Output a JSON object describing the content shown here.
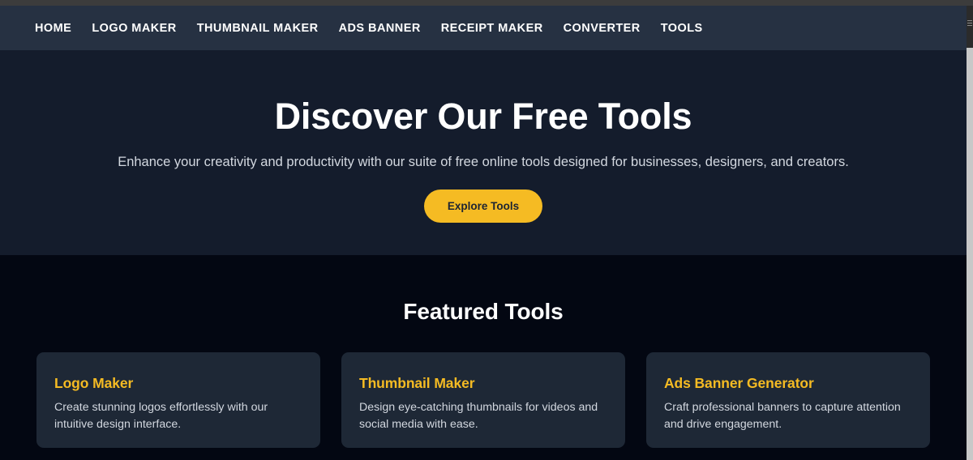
{
  "navbar": {
    "links": [
      {
        "label": "HOME",
        "name": "nav-link-home"
      },
      {
        "label": "LOGO MAKER",
        "name": "nav-link-logo-maker"
      },
      {
        "label": "THUMBNAIL MAKER",
        "name": "nav-link-thumbnail-maker"
      },
      {
        "label": "ADS BANNER",
        "name": "nav-link-ads-banner"
      },
      {
        "label": "RECEIPT MAKER",
        "name": "nav-link-receipt-maker"
      },
      {
        "label": "CONVERTER",
        "name": "nav-link-converter"
      },
      {
        "label": "TOOLS",
        "name": "nav-link-tools"
      }
    ],
    "background_color": "#263142",
    "text_color": "#ffffff"
  },
  "hero": {
    "title": "Discover Our Free Tools",
    "subtitle": "Enhance your creativity and productivity with our suite of free online tools designed for businesses, designers, and creators.",
    "cta_label": "Explore Tools",
    "background_color": "#141c2c",
    "cta_color": "#f5bb23",
    "cta_text_color": "#1d2433"
  },
  "featured": {
    "heading": "Featured Tools",
    "background_color": "#030712",
    "card_background_color": "#1e2836",
    "card_title_color": "#f5bb23",
    "cards": [
      {
        "title": "Logo Maker",
        "description": "Create stunning logos effortlessly with our intuitive design interface."
      },
      {
        "title": "Thumbnail Maker",
        "description": "Design eye-catching thumbnails for videos and social media with ease."
      },
      {
        "title": "Ads Banner Generator",
        "description": "Craft professional banners to capture attention and drive engagement."
      }
    ]
  }
}
